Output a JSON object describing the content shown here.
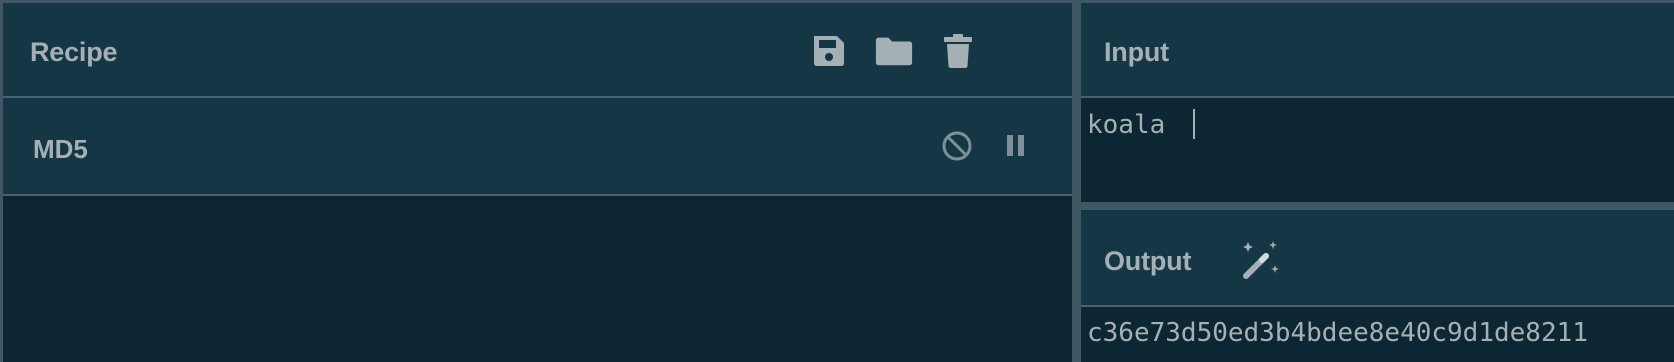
{
  "recipe": {
    "title": "Recipe",
    "toolbar": {
      "save_icon": "save-icon",
      "open_icon": "folder-icon",
      "clear_icon": "trash-icon"
    },
    "operations": [
      {
        "name": "MD5",
        "disable_icon": "disable-icon",
        "breakpoint_icon": "pause-icon"
      }
    ]
  },
  "input": {
    "title": "Input",
    "value": "koala "
  },
  "output": {
    "title": "Output",
    "magic_icon": "magic-wand-icon",
    "value": "c36e73d50ed3b4bdee8e40c9d1de8211"
  },
  "colors": {
    "background": "#0c2733",
    "header": "#153644",
    "text": "#a5b0b5",
    "border": "#4a626d"
  }
}
